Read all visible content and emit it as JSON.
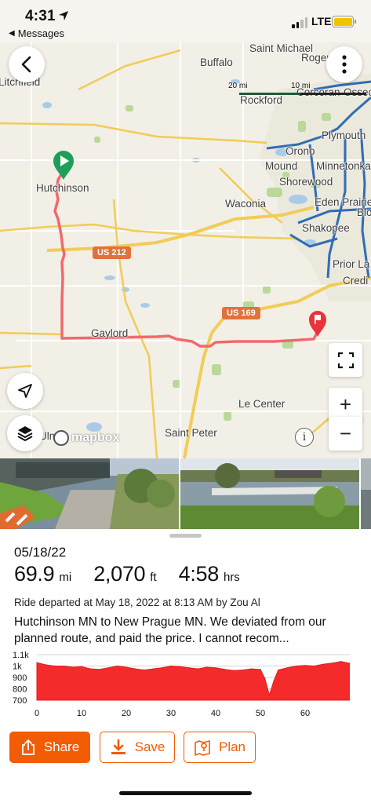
{
  "status_bar": {
    "time": "4:31",
    "back_app": "Messages",
    "network": "LTE",
    "signal_bars": 2,
    "battery_color": "#f3c200"
  },
  "map": {
    "labels": {
      "saint_michael": "Saint Michael",
      "rogers": "Rogers",
      "buffalo": "Buffalo",
      "litchfield": "Litchfield",
      "rockford": "Rockford",
      "corcoran": "Corcoran",
      "osseo": "Osseo",
      "plymouth": "Plymouth",
      "orono": "Orono",
      "mound": "Mound",
      "minnetonka": "Minnetonka",
      "shorewood": "Shorewood",
      "eden_prairie": "Eden Prairie",
      "bloomington": "Blo",
      "hutchinson": "Hutchinson",
      "waconia": "Waconia",
      "shakopee": "Shakopee",
      "prior_lake": "Prior La",
      "credit_river": "Credi",
      "gaylord": "Gaylord",
      "le_center": "Le Center",
      "saint_peter": "Saint Peter",
      "ulm": "Ulm"
    },
    "shields": {
      "us212": "US 212",
      "us169": "US 169"
    },
    "scale": {
      "left": "20 mi",
      "right": "10 mi"
    },
    "attribution": "mapbox",
    "route_color": "#f0696c",
    "start_marker_color": "#1e9e58",
    "end_marker_color": "#e8323c"
  },
  "ride": {
    "date": "05/18/22",
    "distance": "69.9",
    "distance_unit": "mi",
    "elevation": "2,070",
    "elevation_unit": "ft",
    "duration": "4:58",
    "duration_unit": "hrs",
    "departed": "Ride departed at May 18, 2022 at 8:13 AM by Zou Al",
    "description": "Hutchinson MN to New Prague MN.  We deviated from our planned route, and paid the price.  I cannot recom..."
  },
  "chart_data": {
    "type": "area",
    "xlabel": "",
    "ylabel": "",
    "x_ticks": [
      "0",
      "10",
      "20",
      "30",
      "40",
      "50",
      "60"
    ],
    "y_ticks": [
      "1.1k",
      "1k",
      "900",
      "800",
      "700"
    ],
    "xlim": [
      0,
      70
    ],
    "ylim": [
      700,
      1100
    ],
    "grid": true,
    "color": "#f52b2b",
    "x": [
      0,
      2,
      4,
      6,
      8,
      10,
      12,
      14,
      16,
      18,
      20,
      22,
      24,
      26,
      28,
      30,
      32,
      34,
      36,
      38,
      40,
      42,
      44,
      46,
      48,
      50,
      51,
      52,
      53,
      54,
      56,
      58,
      60,
      62,
      64,
      66,
      68,
      69.9
    ],
    "values": [
      1030,
      1010,
      1000,
      1000,
      990,
      995,
      975,
      970,
      985,
      1000,
      990,
      975,
      965,
      975,
      985,
      1000,
      995,
      985,
      975,
      990,
      985,
      970,
      960,
      965,
      975,
      970,
      890,
      745,
      870,
      965,
      985,
      1000,
      1005,
      1000,
      1015,
      1025,
      1040,
      1025
    ]
  },
  "actions": {
    "share": "Share",
    "save": "Save",
    "plan": "Plan"
  }
}
